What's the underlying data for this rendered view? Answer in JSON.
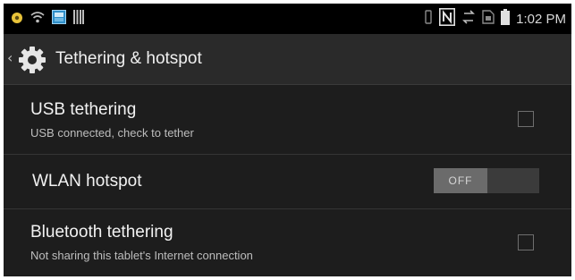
{
  "status_bar": {
    "left_icons": [
      "notification-dot-icon",
      "wifi-icon",
      "image-notification-icon",
      "bars-icon"
    ],
    "right_icons": [
      "vibrate-icon",
      "nfc-icon",
      "sync-icon",
      "sim-icon",
      "battery-icon"
    ],
    "time": "1:02 PM"
  },
  "action_bar": {
    "title": "Tethering & hotspot",
    "icon": "gear-icon"
  },
  "settings": [
    {
      "title": "USB tethering",
      "summary": "USB connected, check to tether",
      "control": "checkbox",
      "checked": false
    },
    {
      "title": "WLAN hotspot",
      "control": "switch",
      "switch_label": "OFF",
      "on": false
    },
    {
      "title": "Bluetooth tethering",
      "summary": "Not sharing this tablet's Internet connection",
      "control": "checkbox",
      "checked": false
    }
  ],
  "colors": {
    "background": "#1d1d1d",
    "status_bar": "#000000",
    "action_bar": "#2a2a2a",
    "accent_icon": "#e8c33a"
  }
}
